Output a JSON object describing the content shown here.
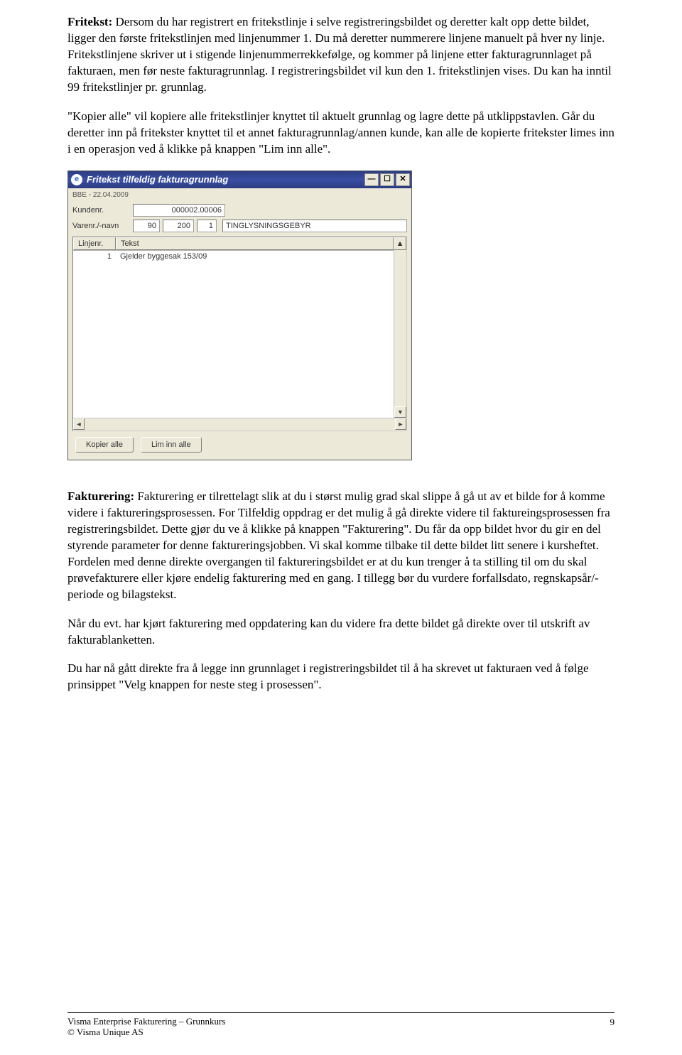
{
  "paragraphs": {
    "p1_label": "Fritekst:",
    "p1": " Dersom du har registrert en fritekstlinje i selve registreringsbildet og deretter kalt opp dette bildet, ligger den første fritekstlinjen med linjenummer 1. Du må deretter nummerere linjene manuelt på hver ny linje. Fritekstlinjene skriver ut i stigende linjenummerrekkefølge, og kommer på linjene etter fakturagrunnlaget på fakturaen, men før neste fakturagrunnlag. I registreringsbildet vil kun den 1. fritekstlinjen vises. Du kan ha inntil 99 fritekstlinjer pr. grunnlag.",
    "p2": "\"Kopier alle\" vil kopiere alle fritekstlinjer knyttet til aktuelt grunnlag og lagre dette på utklippstavlen. Går du deretter inn på fritekster knyttet til et annet fakturagrunnlag/annen kunde, kan alle de kopierte fritekster limes inn i en operasjon ved å klikke på knappen \"Lim inn alle\".",
    "p3_label": "Fakturering:",
    "p3": " Fakturering er tilrettelagt slik at du i størst mulig grad skal slippe å gå ut av et bilde for å komme videre i faktureringsprosessen. For Tilfeldig oppdrag er det mulig å gå direkte videre til faktureingsprosessen fra registreringsbildet. Dette gjør du ve å klikke på knappen \"Fakturering\". Du får da opp bildet hvor du gir en del styrende parameter for denne faktureringsjobben. Vi skal komme tilbake til dette bildet litt senere i kursheftet. Fordelen med denne direkte overgangen til faktureringsbildet er at du kun trenger å ta stilling til om du skal prøvefakturere eller kjøre endelig fakturering med en gang. I tillegg bør du vurdere forfallsdato, regnskapsår/-periode og bilagstekst.",
    "p4": "Når du evt. har kjørt fakturering med oppdatering kan du videre fra dette bildet gå direkte over til utskrift av fakturablanketten.",
    "p5": "Du har nå gått direkte fra å legge inn grunnlaget i registreringsbildet til å ha skrevet ut fakturaen ved å følge prinsippet \"Velg knappen for neste steg i prosessen\"."
  },
  "window": {
    "title": "Fritekst tilfeldig fakturagrunnlag",
    "subheader": "BBE - 22.04.2009",
    "labels": {
      "kundenr": "Kundenr.",
      "varenr": "Varenr./-navn"
    },
    "fields": {
      "kundenr": "000002.00006",
      "vare1": "90",
      "vare2": "200",
      "vare3": "1",
      "varenavn": "TINGLYSNINGSGEBYR"
    },
    "grid": {
      "headers": {
        "col1": "Linjenr.",
        "col2": "Tekst"
      },
      "rows": [
        {
          "nr": "1",
          "tekst": "Gjelder byggesak 153/09"
        }
      ]
    },
    "buttons": {
      "kopier": "Kopier alle",
      "lim": "Lim inn alle"
    },
    "scroll": {
      "up": "▲",
      "down": "▼",
      "left": "◄",
      "right": "►"
    }
  },
  "footer": {
    "line1": "Visma Enterprise Fakturering – Grunnkurs",
    "line2": "© Visma Unique AS",
    "page": "9"
  }
}
